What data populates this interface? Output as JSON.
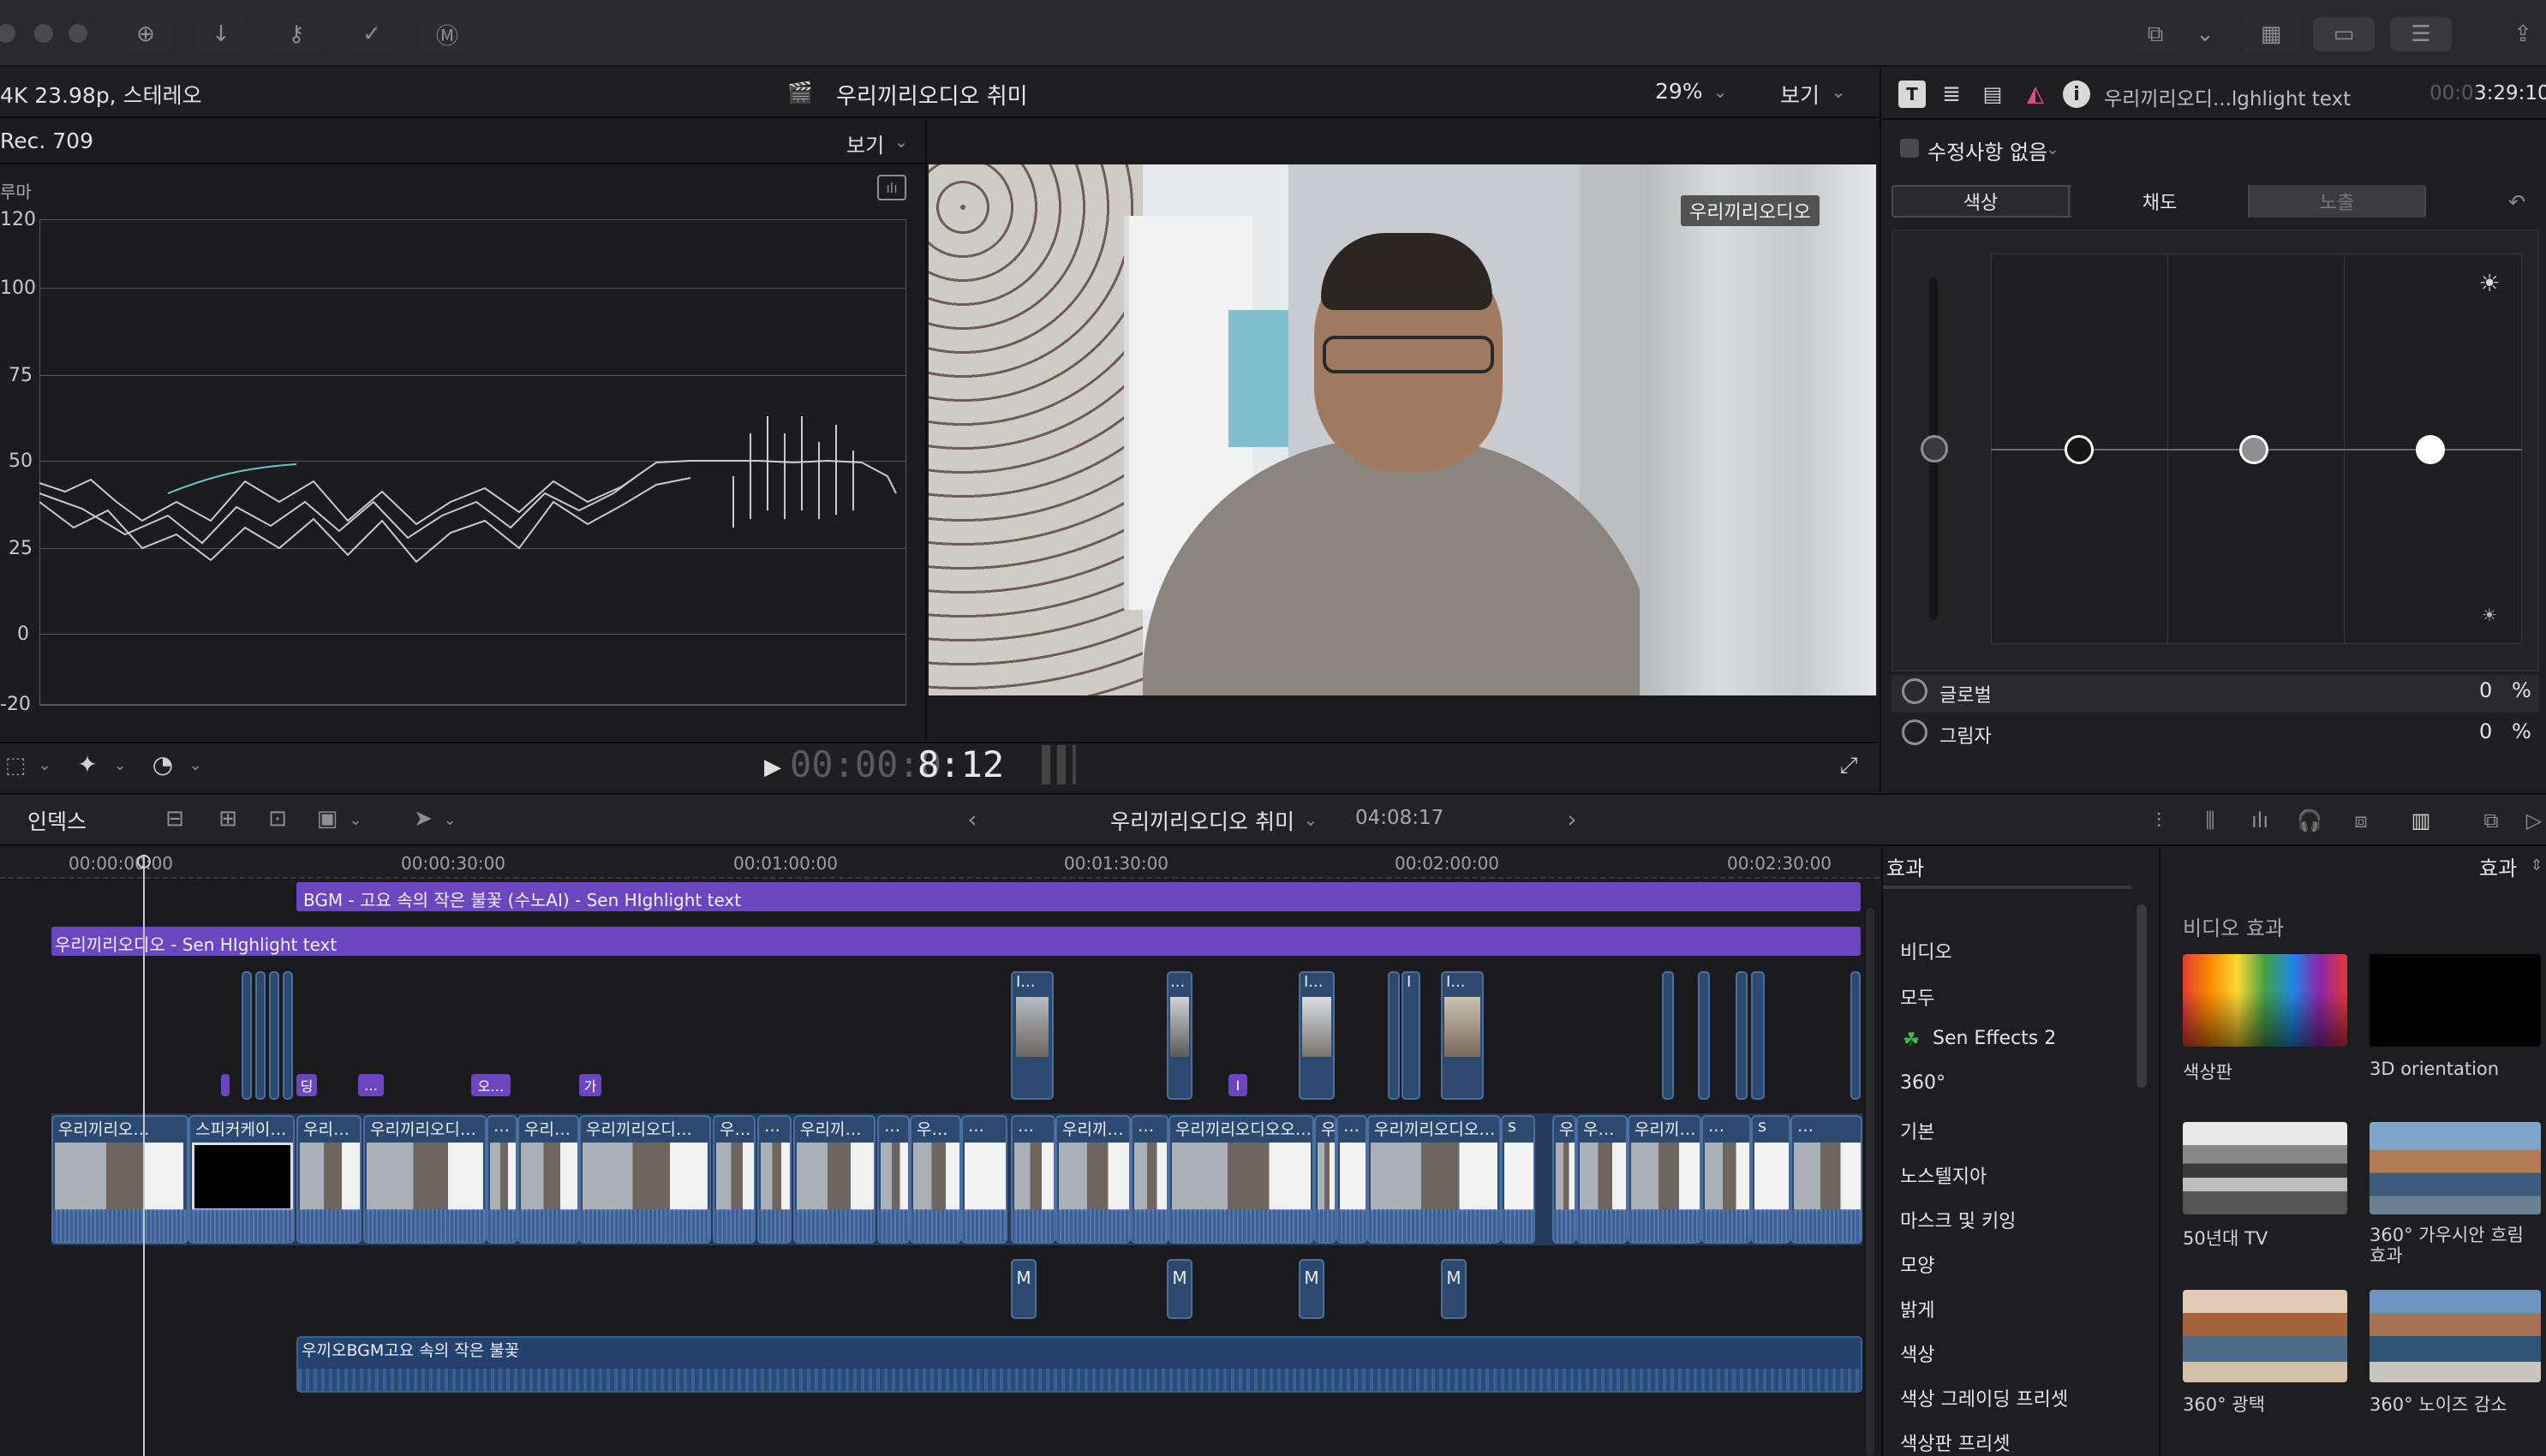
{
  "window": {
    "format_label": "4K 23.98p, 스테레오",
    "project_title": "우리끼리오디오 취미",
    "zoom": "29%",
    "view_label": "보기"
  },
  "scope": {
    "color_space": "Rec. 709",
    "view_label": "보기",
    "title": "루마",
    "scale_labels": [
      "120",
      "100",
      "75",
      "50",
      "25",
      "0",
      "-20"
    ]
  },
  "viewer": {
    "overlay_title": "우리끼리오디오",
    "timecode_dim": "00:00:0",
    "timecode_bright": "8:12"
  },
  "inspector": {
    "clip_name": "우리끼리오디...lghlight text",
    "duration_dim": "00:0",
    "duration_bright": "3:29:10",
    "corrections_label": "수정사항 없음",
    "tabs": [
      "색상",
      "채도",
      "노출"
    ],
    "rows": [
      {
        "label": "글로벌",
        "value": "0",
        "unit": "%"
      },
      {
        "label": "그림자",
        "value": "0",
        "unit": "%"
      }
    ]
  },
  "timeline": {
    "index_label": "인덱스",
    "project_name": "우리끼리오디오 취미",
    "duration": "04:08:17",
    "ruler": [
      "00:00:00:00",
      "00:00:30:00",
      "00:01:00:00",
      "00:01:30:00",
      "00:02:00:00",
      "00:02:30:00"
    ],
    "bgm_title_bar": "BGM - 고요 속의 작은 불꽃 (수노AI) - Sen HIghlight text",
    "title_bar": "우리끼리오디오 - Sen HIghlight text",
    "bgm_audio": "우끼오BGM고요 속의 작은 불꽃",
    "clips": [
      "우리끼리오…",
      "스피커케이…",
      "우리…",
      "우리끼리오디…",
      "…",
      "우리…",
      "우리끼리오디…",
      "우…",
      "…",
      "우리끼…",
      "…",
      "우…",
      "…",
      "…",
      "우리끼…",
      "…",
      "우리끼리오디오오…",
      "우",
      "…",
      "우리끼리오디오…",
      "s",
      "우",
      "우…",
      "우리끼…",
      "…",
      "s",
      "…"
    ],
    "markers": [
      "딩",
      "…",
      "오…",
      "가",
      "I"
    ],
    "connected_labels": [
      "I...",
      "...",
      "I...",
      "I",
      "I..."
    ],
    "m_chip": "M"
  },
  "effects": {
    "sidebar_title": "효과",
    "browser_title": "효과",
    "section_title": "비디오 효과",
    "categories": [
      "비디오",
      "모두",
      "Sen Effects 2",
      "360°",
      "기본",
      "노스텔지아",
      "마스크 및 키잉",
      "모양",
      "밝게",
      "색상",
      "색상 그레이딩 프리셋",
      "색상판 프리셋"
    ],
    "tiles": [
      "색상판",
      "3D orientation",
      "50년대 TV",
      "360° 가우시안 흐림 효과",
      "360° 광택",
      "360° 노이즈 감소"
    ]
  },
  "colors": {
    "accent_purple": "#6b46c1",
    "clip_blue": "#2e4970",
    "bg": "#1d1d1f"
  }
}
